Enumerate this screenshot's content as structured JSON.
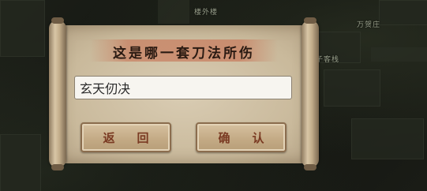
{
  "map": {
    "labels": [
      "楼外楼",
      "万贺庄",
      "子客栈"
    ]
  },
  "dialog": {
    "title": "这是哪一套刀法所伤",
    "answer": {
      "value": "玄天仞决",
      "placeholder": ""
    },
    "back_label": "返回",
    "confirm_label": "确认"
  }
}
